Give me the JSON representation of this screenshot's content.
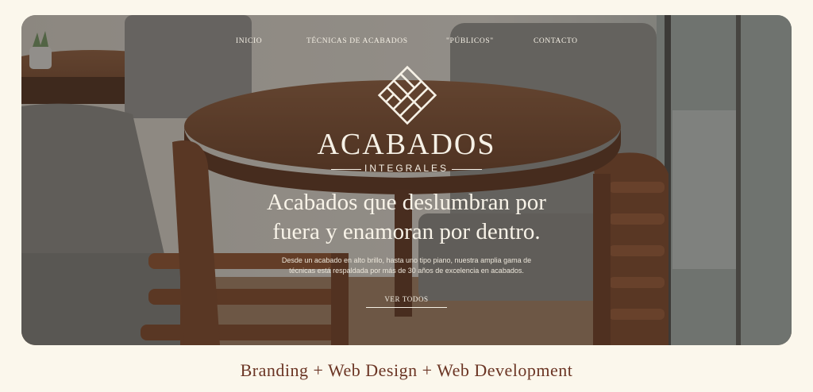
{
  "nav": {
    "items": [
      {
        "label": "INICIO"
      },
      {
        "label": "TÉCNICAS DE ACABADOS"
      },
      {
        "label": "\"PÚBLICOS\""
      },
      {
        "label": "CONTACTO"
      }
    ]
  },
  "brand": {
    "name": "ACABADOS",
    "subtitle": "INTEGRALES",
    "logo_icon": "woven-squares-logo-icon"
  },
  "hero": {
    "headline_line1": "Acabados que deslumbran por",
    "headline_line2": "fuera y enamoran por dentro.",
    "description_line1": "Desde un acabado en alto brillo, hasta uno tipo piano, nuestra amplia gama de",
    "description_line2": "técnicas está respaldada por más de 30 años de excelencia en acabados.",
    "cta_label": "VER TODOS",
    "background": "cafe-table-chairs-photo"
  },
  "caption": "Branding + Web Design + Web Development",
  "colors": {
    "page_background": "#fbf7ec",
    "caption_text": "#6b3524",
    "hero_text": "#f6f1e6",
    "wood": "#6e4026",
    "upholstery": "#8b8a86"
  }
}
